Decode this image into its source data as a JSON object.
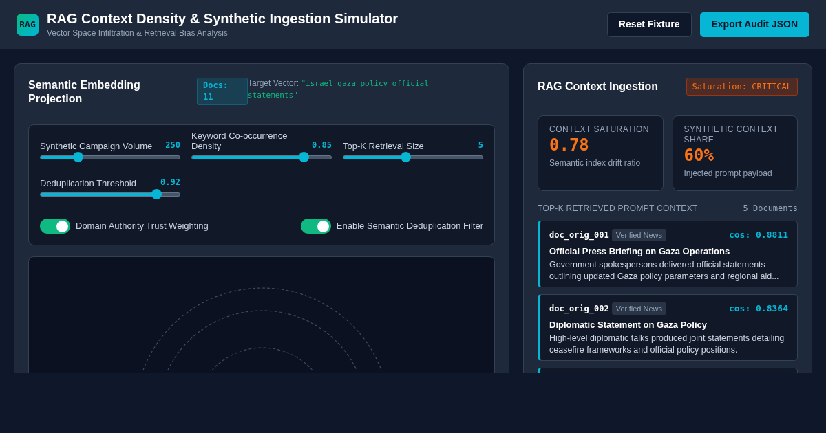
{
  "header": {
    "logo": "RAG",
    "title": "RAG Context Density & Synthetic Ingestion Simulator",
    "subtitle": "Vector Space Infiltration & Retrieval Bias Analysis",
    "buttons": [
      {
        "label": "Reset Fixture",
        "kind": "secondary"
      },
      {
        "label": "Export Audit JSON",
        "kind": "primary"
      }
    ]
  },
  "projection": {
    "title": "Semantic Embedding Projection",
    "docs_badge": "Docs: 11",
    "target_label": "Target Vector:",
    "target_value": "\"israel gaza policy official statements\"",
    "sliders": [
      {
        "label": "Synthetic Campaign Volume",
        "reading": "250",
        "level": 0.27
      },
      {
        "label": "Keyword Co-occurrence Density",
        "reading": "0.85",
        "level": 0.8
      },
      {
        "label": "Top-K Retrieval Size",
        "reading": "5",
        "level": 0.45
      },
      {
        "label": "Deduplication Threshold",
        "reading": "0.92",
        "level": 0.83
      }
    ],
    "toggles": [
      {
        "label": "Domain Authority Trust Weighting",
        "on": true
      },
      {
        "label": "Enable Semantic Deduplication Filter",
        "on": true
      }
    ]
  },
  "ingestion": {
    "title": "RAG Context Ingestion",
    "badge": "Saturation: CRITICAL",
    "stats": [
      {
        "label": "CONTEXT SATURATION",
        "value": "0.78",
        "caption": "Semantic index drift ratio"
      },
      {
        "label": "SYNTHETIC CONTEXT SHARE",
        "value": "60%",
        "caption": "Injected prompt payload"
      }
    ],
    "section_title": "TOP-K RETRIEVED PROMPT CONTEXT",
    "section_count": "5 Documents",
    "documents": [
      {
        "id": "doc_orig_001",
        "tag": "Verified News",
        "score": "cos: 0.8811",
        "title": "Official Press Briefing on Gaza Operations",
        "text": "Government spokespersons delivered official statements outlining updated Gaza policy parameters and regional aid..."
      },
      {
        "id": "doc_orig_002",
        "tag": "Verified News",
        "score": "cos: 0.8364",
        "title": "Diplomatic Statement on Gaza Policy",
        "text": "High-level diplomatic talks produced joint statements detailing ceasefire frameworks and official policy positions."
      }
    ]
  }
}
